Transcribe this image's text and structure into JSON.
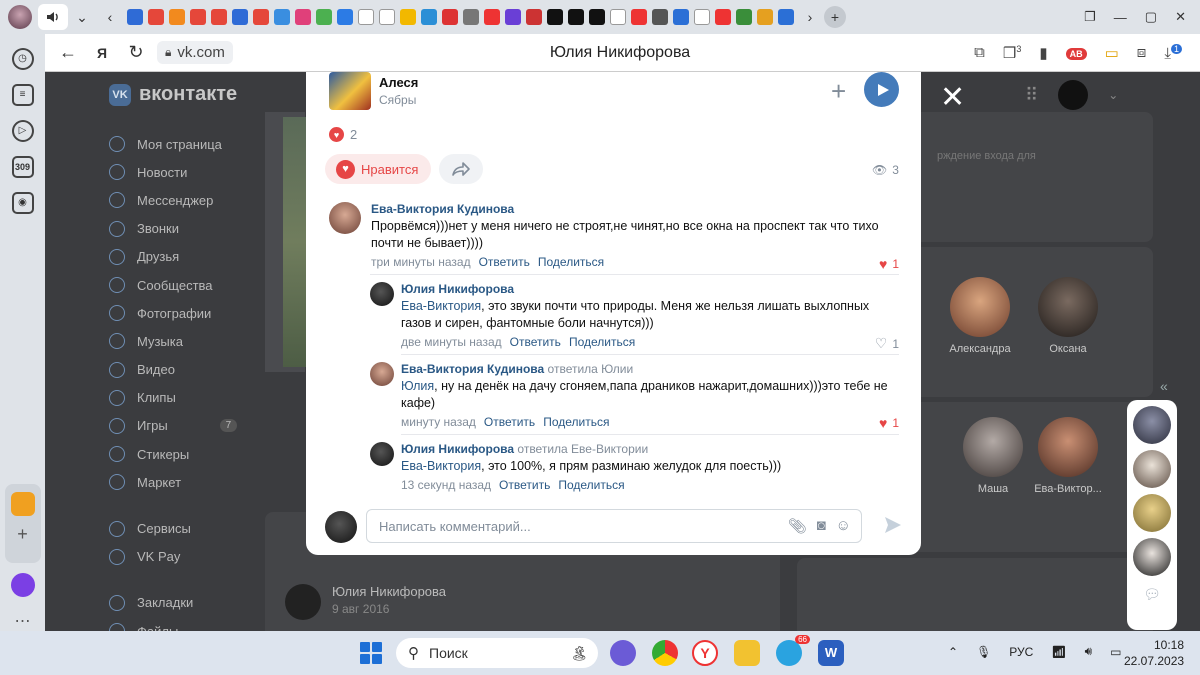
{
  "browser": {
    "url": "vk.com",
    "page_title": "Юлия Никифорова",
    "tab_badge_count": "3",
    "downloads_badge": "1"
  },
  "sidebar_badge": "309",
  "vk": {
    "logo_text": "вконтакте",
    "nav": [
      {
        "label": "Моя страница",
        "icon": "profile-icon"
      },
      {
        "label": "Новости",
        "icon": "news-icon"
      },
      {
        "label": "Мессенджер",
        "icon": "messenger-icon"
      },
      {
        "label": "Звонки",
        "icon": "phone-icon"
      },
      {
        "label": "Друзья",
        "icon": "friends-icon"
      },
      {
        "label": "Сообщества",
        "icon": "communities-icon"
      },
      {
        "label": "Фотографии",
        "icon": "photos-icon"
      },
      {
        "label": "Музыка",
        "icon": "music-icon"
      },
      {
        "label": "Видео",
        "icon": "video-icon"
      },
      {
        "label": "Клипы",
        "icon": "clips-icon"
      },
      {
        "label": "Игры",
        "icon": "games-icon",
        "count": "7"
      },
      {
        "label": "Стикеры",
        "icon": "stickers-icon"
      },
      {
        "label": "Маркет",
        "icon": "market-icon"
      }
    ],
    "nav2": [
      {
        "label": "Сервисы",
        "icon": "services-icon"
      },
      {
        "label": "VK Pay",
        "icon": "vkpay-icon"
      }
    ],
    "nav3": [
      {
        "label": "Закладки",
        "icon": "bookmarks-icon"
      },
      {
        "label": "Файлы",
        "icon": "files-icon"
      }
    ],
    "friends_row1": [
      "Александра",
      "Оксана"
    ],
    "friends_row2": [
      "Маша",
      "Ева-Виктор..."
    ],
    "post_author": "Юлия Никифорова",
    "post_date": "9 авг 2016",
    "tfa_text": "рждение входа для"
  },
  "modal": {
    "track": {
      "title": "Алеся",
      "artist": "Сябры"
    },
    "likes_count": "2",
    "like_button": "Нравится",
    "views": "3",
    "comments": [
      {
        "author": "Ева-Виктория Кудинова",
        "reply_to": "",
        "mention": "",
        "text": "Прорвёмся)))нет у меня ничего не строят,не чинят,но все окна на проспект так что тихо почти не бывает))))",
        "time": "три минуты назад",
        "reply": "Ответить",
        "share": "Поделиться",
        "likes": "1",
        "liked": true
      },
      {
        "author": "Юлия Никифорова",
        "reply_to": "",
        "mention": "Ева-Виктория",
        "text": ", это звуки почти что природы. Меня же нельзя лишать выхлопных газов и сирен, фантомные боли начнутся)))",
        "time": "две минуты назад",
        "reply": "Ответить",
        "share": "Поделиться",
        "likes": "1",
        "liked": false
      },
      {
        "author": "Ева-Виктория Кудинова",
        "reply_to": "ответила Юлии",
        "mention": "Юлия",
        "text": ", ну на денёк на дачу сгоняем,папа драников нажарит,домашних)))это тебе не кафе)",
        "time": "минуту назад",
        "reply": "Ответить",
        "share": "Поделиться",
        "likes": "1",
        "liked": true
      },
      {
        "author": "Юлия Никифорова",
        "reply_to": "ответила Еве-Виктории",
        "mention": "Ева-Виктория",
        "text": ", это 100%, я прям разминаю желудок для поесть)))",
        "time": "13 секунд назад",
        "reply": "Ответить",
        "share": "Поделиться",
        "likes": "",
        "liked": false
      }
    ],
    "comment_placeholder": "Написать комментарий..."
  },
  "taskbar": {
    "search_label": "Поиск",
    "telegram_badge": "66",
    "language": "РУС",
    "time": "10:18",
    "date": "22.07.2023"
  },
  "colors": {
    "vk_link": "#2a5885",
    "like_red": "#e64646",
    "play_blue": "#447bba",
    "meta_grey": "#818c99"
  }
}
